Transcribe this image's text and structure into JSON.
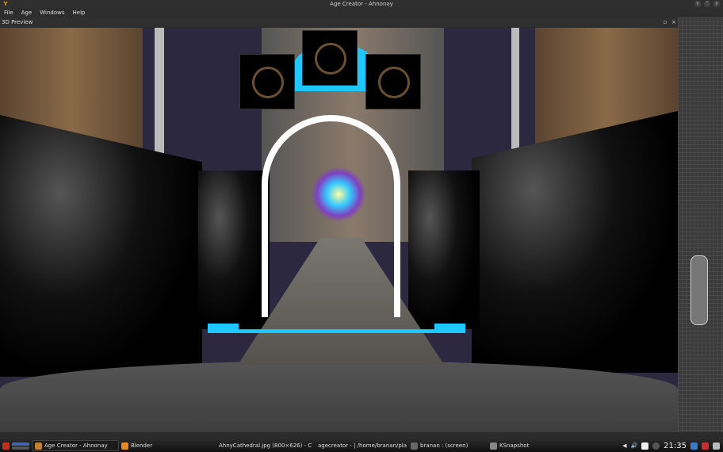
{
  "window": {
    "title": "Age Creator - Ahnonay",
    "buttons": [
      "v",
      "^",
      "x"
    ]
  },
  "menu": [
    "File",
    "Age",
    "Windows",
    "Help"
  ],
  "dock": {
    "title": "3D Preview",
    "float": "▫",
    "close": "×"
  },
  "taskbar": {
    "tasks": [
      {
        "label": "Age Creator - Ahnonay",
        "active": true,
        "width": 110,
        "color": "#c08030"
      },
      {
        "label": "Blender",
        "width": 120,
        "color": "#e88a20"
      },
      {
        "label": "AhnyCathedral.jpg (800×626) - C",
        "width": 125,
        "color": "#3a7ad8"
      },
      {
        "label": "agecreator - | /home/branan/pla",
        "width": 120,
        "color": "#5ab040"
      },
      {
        "label": "branan : (screen)",
        "width": 100,
        "color": "#666"
      },
      {
        "label": "KSnapshot",
        "width": 90,
        "color": "#888"
      }
    ],
    "clock": "21:35"
  }
}
